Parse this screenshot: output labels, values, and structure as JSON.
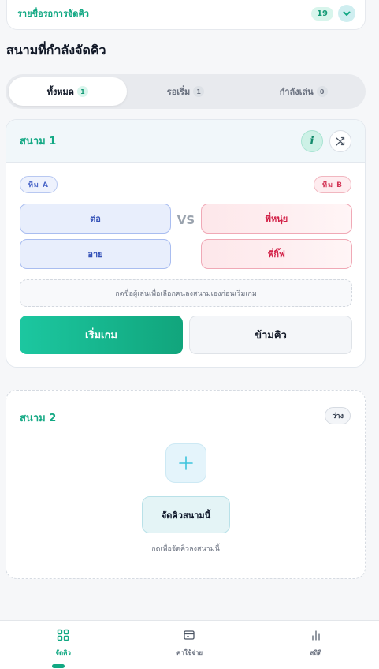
{
  "queue_list": {
    "title": "รายชื่อรอการจัดคิว",
    "count": "19",
    "toggle_icon": "chevron-down-icon"
  },
  "section_title": "สนามที่กำลังจัดคิว",
  "tabs": [
    {
      "label": "ทั้งหมด",
      "count": "1",
      "active": true
    },
    {
      "label": "รอเริ่ม",
      "count": "1",
      "active": false
    },
    {
      "label": "กำลังเล่น",
      "count": "0",
      "active": false
    }
  ],
  "court1": {
    "name": "สนาม 1",
    "info_icon_glyph": "i",
    "team_a_label": "ทีม A",
    "team_b_label": "ทีม B",
    "team_a_players": [
      "ต่อ",
      "อาย"
    ],
    "team_b_players": [
      "พี่หนุ่ย",
      "พี่กิ๊ฟ"
    ],
    "vs_label": "VS",
    "hint": "กดชื่อผู้เล่นเพื่อเลือกคนลงสนามเองก่อนเริ่มเกม",
    "start_label": "เริ่มเกม",
    "skip_label": "ข้ามคิว"
  },
  "court2": {
    "name": "สนาม 2",
    "status": "ว่าง",
    "assign_label": "จัดคิวสนามนี้",
    "assign_hint": "กดเพื่อจัดคิวลงสนามนี้"
  },
  "bottom_nav": [
    {
      "label": "จัดคิว",
      "icon": "grid-icon",
      "active": true
    },
    {
      "label": "ค่าใช้จ่าย",
      "icon": "wallet-icon",
      "active": false
    },
    {
      "label": "สถิติ",
      "icon": "bar-chart-icon",
      "active": false
    }
  ],
  "colors": {
    "accent": "#12a883",
    "team_a": "#3552b8",
    "team_b": "#d21e45"
  }
}
